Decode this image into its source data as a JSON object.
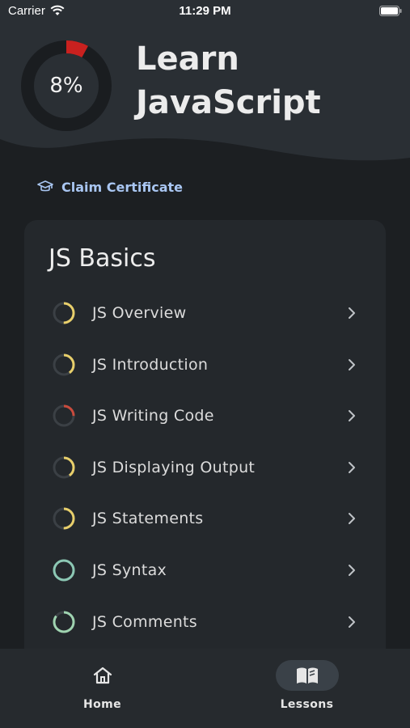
{
  "status_bar": {
    "carrier": "Carrier",
    "time": "11:29 PM",
    "wifi_icon": "wifi-icon",
    "battery_icon": "battery-icon"
  },
  "header": {
    "progress_label": "8%",
    "progress_value": 0.08,
    "title_line1": "Learn",
    "title_line2": "JavaScript"
  },
  "claim": {
    "icon": "graduation-cap-icon",
    "label": "Claim Certificate",
    "color": "#a9c6f2"
  },
  "course": {
    "title": "JS Basics",
    "lessons": [
      {
        "label": "JS Overview",
        "progress": 0.5,
        "color": "#e8cf6b"
      },
      {
        "label": "JS Introduction",
        "progress": 0.4,
        "color": "#e8cf6b"
      },
      {
        "label": "JS Writing Code",
        "progress": 0.25,
        "color": "#c94b3d"
      },
      {
        "label": "JS Displaying Output",
        "progress": 0.4,
        "color": "#e8cf6b"
      },
      {
        "label": "JS Statements",
        "progress": 0.5,
        "color": "#e8cf6b"
      },
      {
        "label": "JS Syntax",
        "progress": 1.0,
        "color": "#8cc8b4"
      },
      {
        "label": "JS Comments",
        "progress": 0.85,
        "color": "#9fd3b0"
      }
    ]
  },
  "tabs": [
    {
      "label": "Home",
      "icon": "home-icon",
      "active": false
    },
    {
      "label": "Lessons",
      "icon": "book-icon",
      "active": true
    }
  ],
  "colors": {
    "background": "#1c1f22",
    "card": "#24282c",
    "accent_red": "#c9211f",
    "track": "#1a1d20"
  }
}
